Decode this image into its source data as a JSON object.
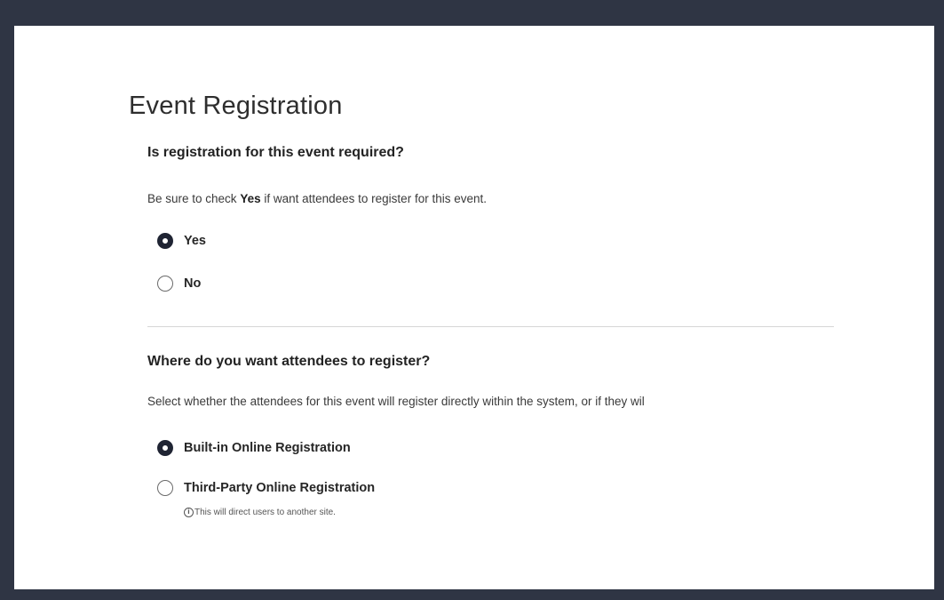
{
  "page": {
    "title": "Event Registration"
  },
  "registration_required": {
    "question": "Is registration for this event required?",
    "help_prefix": "Be sure to check ",
    "help_bold": "Yes",
    "help_suffix": " if want attendees to register for this event.",
    "options": [
      {
        "label": "Yes",
        "selected": true
      },
      {
        "label": "No",
        "selected": false
      }
    ]
  },
  "registration_location": {
    "question": "Where do you want attendees to register?",
    "help": "Select whether the attendees for this event will register directly within the system, or if they wil",
    "options": [
      {
        "label": "Built-in Online Registration",
        "selected": true
      },
      {
        "label": "Third-Party Online Registration",
        "selected": false
      }
    ],
    "third_party_hint": "This will direct users to another site.",
    "hint_icon": "info-icon"
  },
  "colors": {
    "frame": "#2f3544",
    "panel": "#ffffff",
    "radio_selected": "#1f2433",
    "divider": "#d6d6d6"
  }
}
